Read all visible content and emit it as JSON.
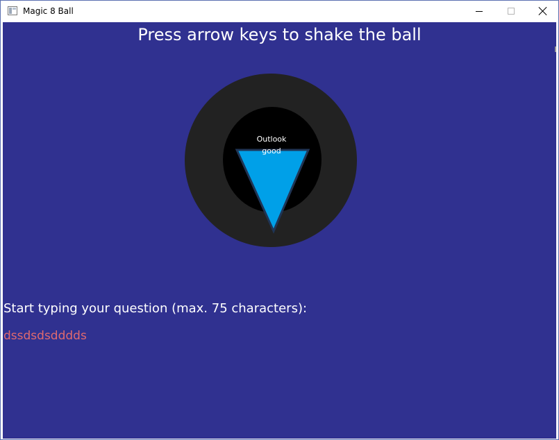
{
  "window": {
    "title": "Magic 8 Ball",
    "icon": "app-window-icon",
    "controls": [
      "minimize-icon",
      "maximize-icon",
      "close-icon"
    ]
  },
  "game": {
    "instruction": "Press arrow keys to shake the ball",
    "answer_line1": "Outlook",
    "answer_line2": "good",
    "prompt": "Start typing your question (max. 75 characters):",
    "question": "dssdsdsdddds"
  },
  "colors": {
    "background": "#303190",
    "ball": "#222222",
    "ball_window": "#000000",
    "answer_triangle": "#00a0e8",
    "answer_triangle_outline": "#1f3556",
    "question_text": "#e06a6f",
    "text": "#ffffff"
  }
}
